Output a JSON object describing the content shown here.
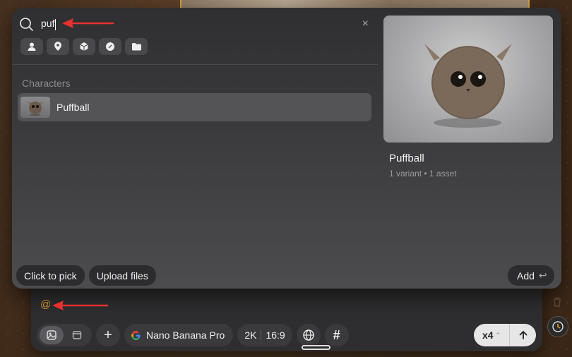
{
  "search": {
    "query": "puf",
    "clear_symbol": "×"
  },
  "filters": [
    {
      "icon": "person-icon"
    },
    {
      "icon": "location-pin-icon"
    },
    {
      "icon": "cube-icon"
    },
    {
      "icon": "compass-icon"
    },
    {
      "icon": "folder-icon"
    }
  ],
  "results": {
    "section_label": "Characters",
    "items": [
      {
        "name": "Puffball"
      }
    ]
  },
  "preview": {
    "name": "Puffball",
    "meta": "1 variant • 1 asset"
  },
  "actions": {
    "click_to_pick": "Click to pick",
    "upload_files": "Upload files",
    "add": "Add",
    "add_icon": "↩"
  },
  "composer": {
    "prompt_text": "@",
    "model": "Nano Banana Pro",
    "resolution": "2K",
    "aspect_ratio": "16:9",
    "hash_symbol": "#",
    "plus_symbol": "+",
    "count": "x4",
    "count_icon": "⌃"
  },
  "colors": {
    "accent": "#e0a030",
    "arrow": "#e8302f"
  }
}
